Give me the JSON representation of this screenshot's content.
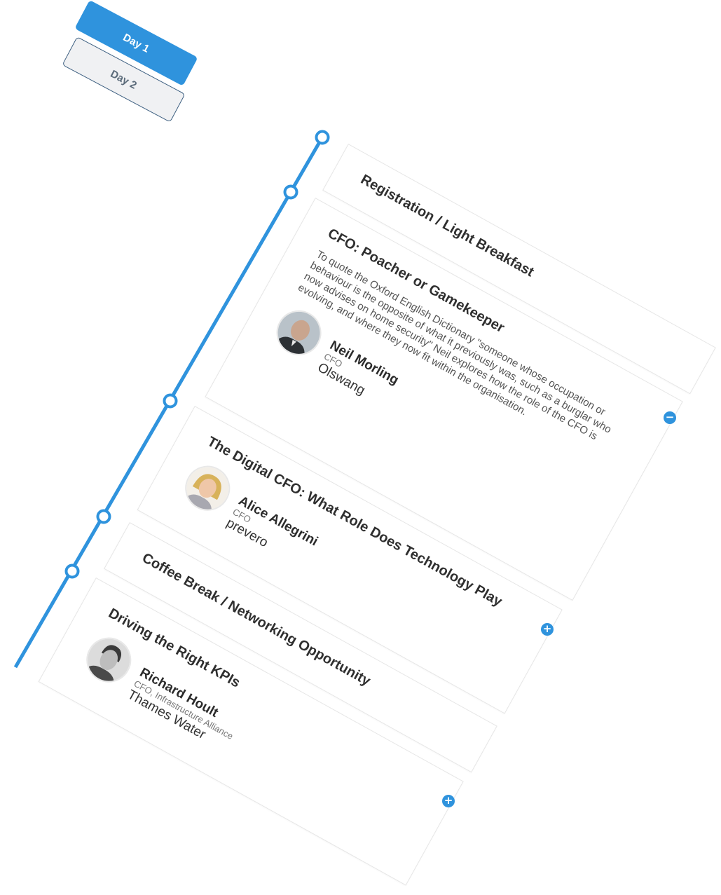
{
  "day_tabs": [
    {
      "label": "Day 1",
      "active": true
    },
    {
      "label": "Day 2",
      "active": false
    }
  ],
  "colors": {
    "accent": "#2f93dd",
    "tab_inactive_bg": "#f0f1f3",
    "tab_inactive_border": "#3d5f80"
  },
  "sessions": [
    {
      "title": "Registration / Light Breakfast"
    },
    {
      "title": "CFO: Poacher or Gamekeeper",
      "description": "To quote the Oxford English Dictionary \"someone whose occupation or behaviour is the opposite of what it previously was, such as a burglar who now advises on home security\" Neil explores how the role of the CFO is evolving, and where they now fit within the organisation.",
      "expanded": true,
      "toggle_icon": "minus-icon",
      "speaker": {
        "name": "Neil Morling",
        "role": "CFO",
        "company": "Olswang"
      }
    },
    {
      "title": "The Digital CFO: What Role Does Technology Play",
      "expanded": false,
      "toggle_icon": "plus-icon",
      "speaker": {
        "name": "Alice Allegrini",
        "role": "CFO",
        "company": "prevero"
      }
    },
    {
      "title": "Coffee Break / Networking Opportunity"
    },
    {
      "title": "Driving the Right KPIs",
      "expanded": false,
      "toggle_icon": "plus-icon",
      "speaker": {
        "name": "Richard Hoult",
        "role": "CFO, Infrastructure Alliance",
        "company": "Thames Water"
      }
    }
  ]
}
